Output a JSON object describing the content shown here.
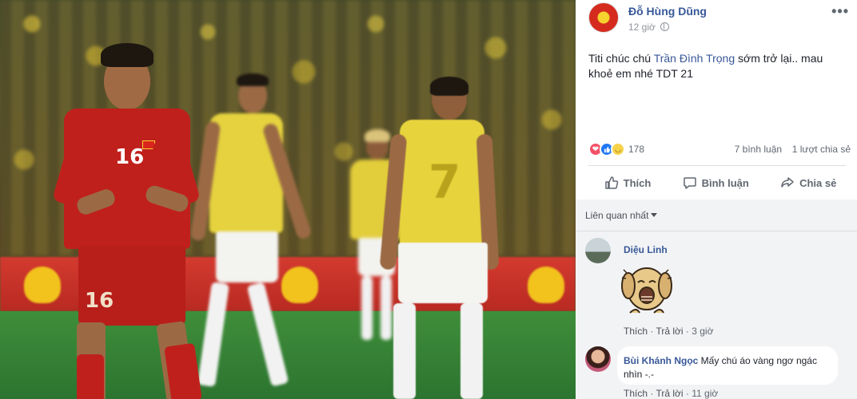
{
  "post": {
    "author": "Đỗ Hùng Dũng",
    "time": "12 giờ",
    "text_before": "Titi chúc chú ",
    "mention": "Trần Đình Trọng",
    "text_after": " sớm trở lại.. mau khoẻ em nhé TDT 21",
    "more_label": "•••"
  },
  "stats": {
    "reaction_count": "178",
    "comments": "7 bình luận",
    "shares": "1 lượt chia sẻ"
  },
  "actions": {
    "like": "Thích",
    "comment": "Bình luận",
    "share": "Chia sẻ"
  },
  "comments_section": {
    "sort_label": "Liên quan nhất",
    "items": [
      {
        "name": "Diệu Linh",
        "text": "",
        "like": "Thích",
        "reply": "Trả lời",
        "time": "3 giờ"
      },
      {
        "name": "Bùi Khánh Ngọc",
        "text": "Mấy chú áo vàng ngơ ngác nhìn -.-",
        "like": "Thích",
        "reply": "Trả lời",
        "time": "11 giờ"
      }
    ]
  },
  "photo": {
    "player_numbers": [
      "16",
      "16",
      "7"
    ]
  },
  "colors": {
    "link": "#385898",
    "meta": "#90949c",
    "vietnam_red": "#c0201c",
    "thai_yellow": "#e7d33c"
  }
}
